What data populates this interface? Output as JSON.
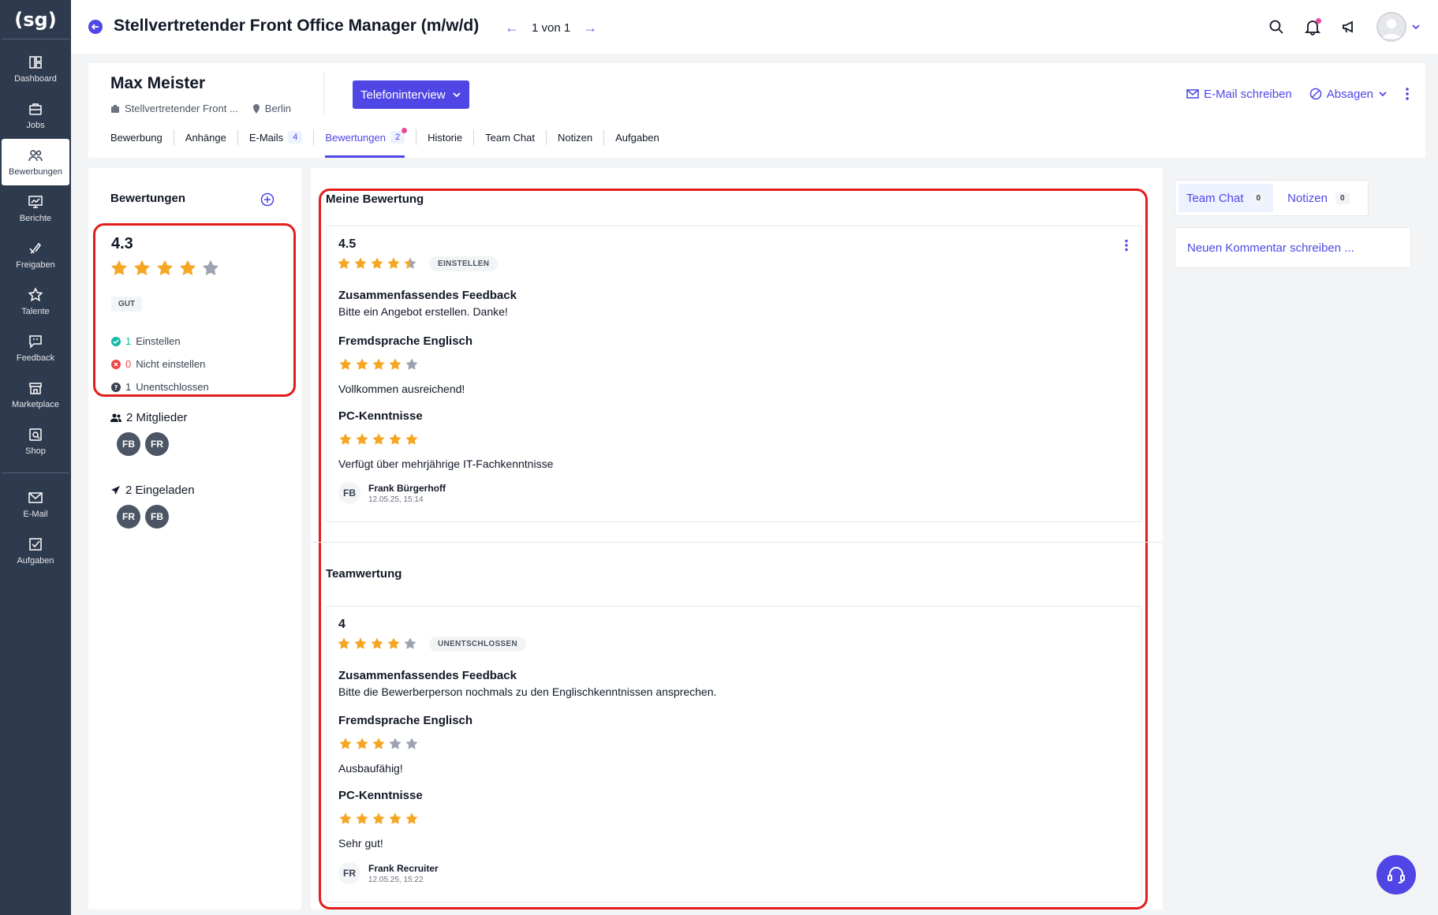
{
  "sidebar": {
    "logo": "(sg)",
    "items": [
      {
        "label": "Dashboard",
        "icon": "dashboard-icon"
      },
      {
        "label": "Jobs",
        "icon": "briefcase-icon"
      },
      {
        "label": "Bewerbungen",
        "icon": "users-icon"
      },
      {
        "label": "Berichte",
        "icon": "chart-icon"
      },
      {
        "label": "Freigaben",
        "icon": "hand-icon"
      },
      {
        "label": "Talente",
        "icon": "star-icon"
      },
      {
        "label": "Feedback",
        "icon": "feedback-icon"
      },
      {
        "label": "Marketplace",
        "icon": "store-icon"
      },
      {
        "label": "Shop",
        "icon": "shop-icon"
      }
    ],
    "bottom_items": [
      {
        "label": "E-Mail",
        "icon": "mail-icon"
      },
      {
        "label": "Aufgaben",
        "icon": "task-icon"
      }
    ]
  },
  "topbar": {
    "title": "Stellvertretender Front Office Manager (m/w/d)",
    "pager": "1 von 1"
  },
  "candidate": {
    "name": "Max Meister",
    "job": "Stellvertretender Front ...",
    "location": "Berlin",
    "stage_button": "Telefoninterview",
    "email_action": "E-Mail schreiben",
    "reject_action": "Absagen",
    "tabs": [
      {
        "label": "Bewerbung",
        "badge": ""
      },
      {
        "label": "Anhänge",
        "badge": ""
      },
      {
        "label": "E-Mails",
        "badge": "4"
      },
      {
        "label": "Bewertungen",
        "badge": "2"
      },
      {
        "label": "Historie",
        "badge": ""
      },
      {
        "label": "Team Chat",
        "badge": ""
      },
      {
        "label": "Notizen",
        "badge": ""
      },
      {
        "label": "Aufgaben",
        "badge": ""
      }
    ]
  },
  "left": {
    "title": "Bewertungen",
    "score": "4.3",
    "stars": 4,
    "rating_label": "GUT",
    "recommendations": [
      {
        "count": "1",
        "label": "Einstellen"
      },
      {
        "count": "0",
        "label": "Nicht einstellen"
      },
      {
        "count": "1",
        "label": "Unentschlossen"
      }
    ],
    "members_label": "2 Mitglieder",
    "members": [
      "FB",
      "FR"
    ],
    "invited_label": "2 Eingeladen",
    "invited": [
      "FR",
      "FB"
    ]
  },
  "middle": {
    "my_title": "Meine Bewertung",
    "team_title": "Teamwertung",
    "my_review": {
      "score": "4.5",
      "stars": 4.5,
      "badge": "EINSTELLEN",
      "summary_label": "Zusammenfassendes Feedback",
      "summary": "Bitte ein Angebot erstellen. Danke!",
      "criteria": [
        {
          "name": "Fremdsprache Englisch",
          "stars": 4,
          "comment": "Vollkommen ausreichend!"
        },
        {
          "name": "PC-Kenntnisse",
          "stars": 5,
          "comment": "Verfügt über mehrjährige IT-Fachkenntnisse"
        }
      ],
      "author_initials": "FB",
      "author": "Frank Bürgerhoff",
      "date": "12.05.25, 15:14"
    },
    "team_review": {
      "score": "4",
      "stars": 4,
      "badge": "UNENTSCHLOSSEN",
      "summary_label": "Zusammenfassendes Feedback",
      "summary": "Bitte die Bewerberperson nochmals zu den Englischkenntnissen ansprechen.",
      "criteria": [
        {
          "name": "Fremdsprache Englisch",
          "stars": 3,
          "comment": "Ausbaufähig!"
        },
        {
          "name": "PC-Kenntnisse",
          "stars": 5,
          "comment": "Sehr gut!"
        }
      ],
      "author_initials": "FR",
      "author": "Frank Recruiter",
      "date": "12.05.25, 15:22"
    }
  },
  "right": {
    "tabs": [
      {
        "label": "Team Chat",
        "count": "0"
      },
      {
        "label": "Notizen",
        "count": "0"
      }
    ],
    "comment_placeholder": "Neuen Kommentar schreiben ..."
  },
  "colors": {
    "accent": "#4f46e5",
    "sidebar": "#2e3a4e",
    "star_on": "#f5a623",
    "star_off": "#9ca3af",
    "highlight": "#e11d1d"
  }
}
